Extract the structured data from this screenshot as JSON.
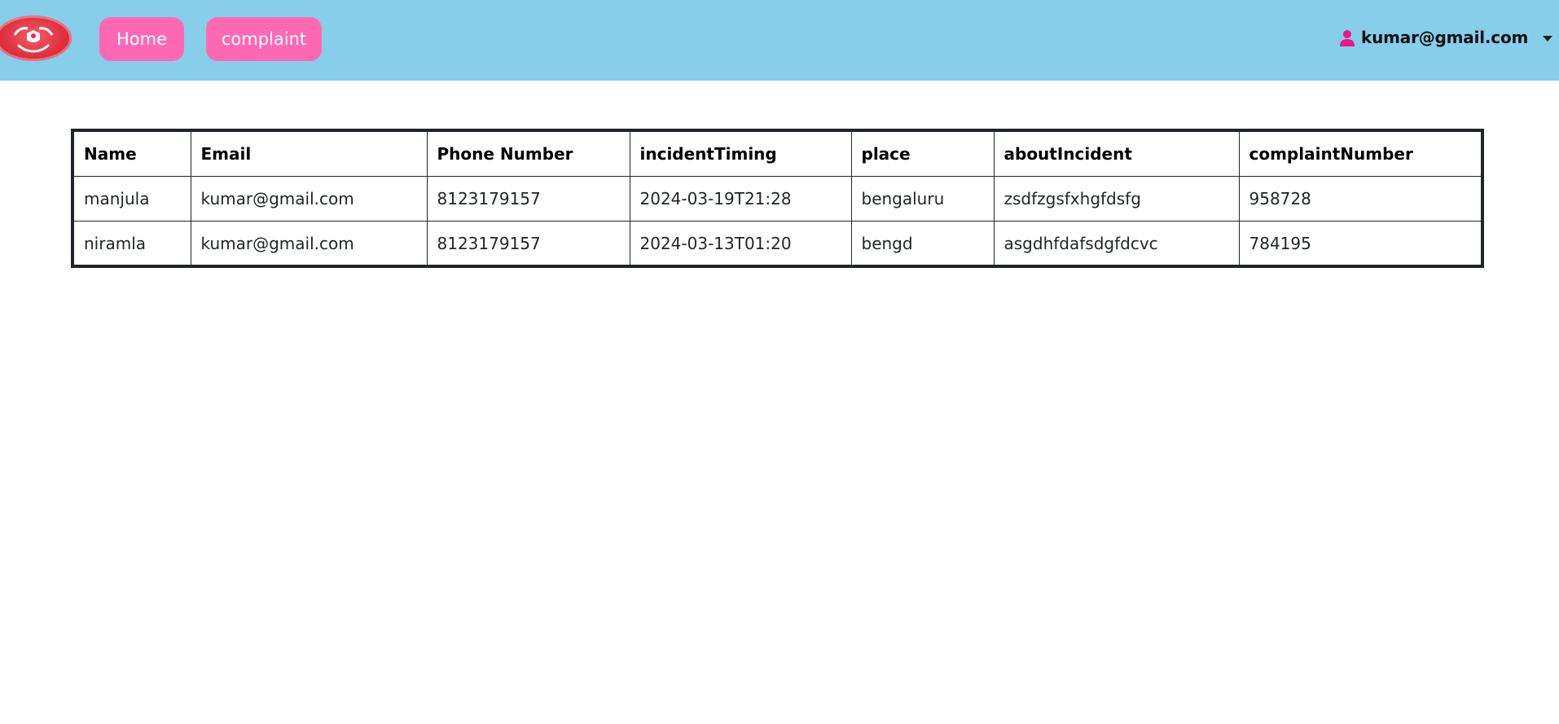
{
  "nav": {
    "logo_icon": "shield-hands-logo",
    "home_label": "Home",
    "complaint_label": "complaint"
  },
  "user": {
    "icon": "user-icon",
    "email": "kumar@gmail.com"
  },
  "colors": {
    "navbar_bg": "#87ceeb",
    "nav_button_bg": "#ff69b4",
    "user_icon": "#e8178a",
    "logo": "#e2313f"
  },
  "table": {
    "headers": [
      "Name",
      "Email",
      "Phone Number",
      "incidentTiming",
      "place",
      "aboutIncident",
      "complaintNumber"
    ],
    "rows": [
      [
        "manjula",
        "kumar@gmail.com",
        "8123179157",
        "2024-03-19T21:28",
        "bengaluru",
        "zsdfzgsfxhgfdsfg",
        "958728"
      ],
      [
        "niramla",
        "kumar@gmail.com",
        "8123179157",
        "2024-03-13T01:20",
        "bengd",
        "asgdhfdafsdgfdcvc",
        "784195"
      ]
    ]
  }
}
